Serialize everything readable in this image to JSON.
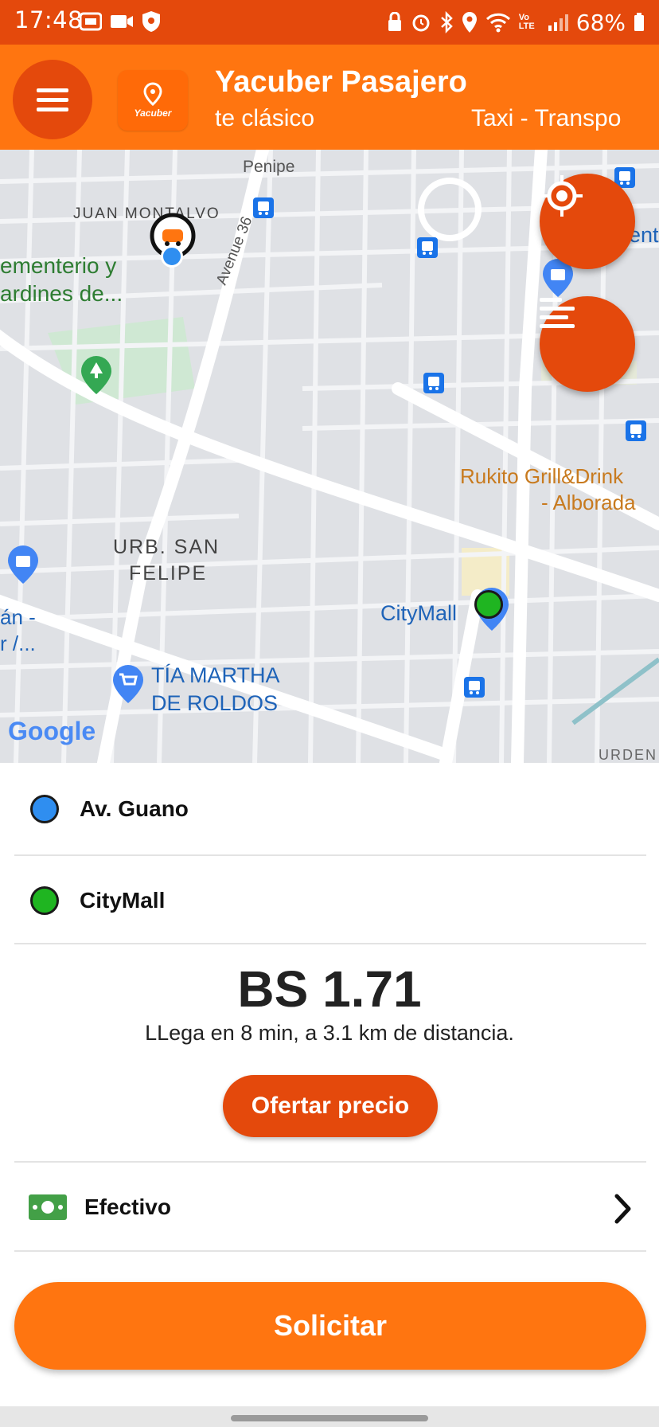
{
  "status_bar": {
    "time": "17:48",
    "battery": "68%",
    "network": "Vo LTE"
  },
  "app_bar": {
    "title": "Yacuber Pasajero",
    "logo_text": "Yacuber",
    "marquee_left": "te clásico",
    "marquee_right": "Taxi - Transpo"
  },
  "map": {
    "labels": {
      "penipe": "Penipe",
      "juan_montalvo": "JUAN MONTALVO",
      "cementerio_1": "ementerio y",
      "cementerio_2": "ardines de...",
      "avenue": "Avenue 36",
      "rukito_1": "Rukito Grill&Drink",
      "rukito_2": "- Alborada",
      "urb_1": "URB. SAN",
      "urb_2": "FELIPE",
      "citymall": "CityMall",
      "left_1": "án -",
      "left_2": "r /...",
      "tia_1": "TÍA MARTHA",
      "tia_2": "DE ROLDOS",
      "urden": "URDEN",
      "ent": "ent",
      "google": "Google"
    }
  },
  "trip": {
    "origin": "Av. Guano",
    "destination": "CityMall",
    "price": "BS 1.71",
    "eta": "LLega en  8 min, a 3.1 km de distancia.",
    "offer_button": "Ofertar precio",
    "payment_method": "Efectivo",
    "request_button": "Solicitar"
  },
  "colors": {
    "status_bar": "#e4490c",
    "app_bar": "#ff7510",
    "accent": "#e4490c",
    "origin_dot": "#2f8ef0",
    "destination_dot": "#1fb521",
    "cash_icon": "#43a047"
  }
}
